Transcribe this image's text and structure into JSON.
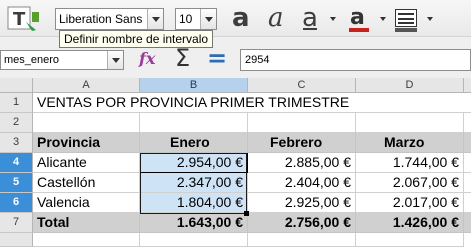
{
  "toolbar": {
    "font_name": "Liberation Sans",
    "font_size": "10",
    "bold_icon": "a",
    "italic_icon": "a",
    "underline_icon": "a",
    "font_color_icon": "a",
    "font_color": "#c9211e",
    "tooltip": "Definir nombre de intervalo"
  },
  "formula_bar": {
    "name_box": "mes_enero",
    "fx_icon": "fx",
    "sum_icon": "Σ",
    "equals_icon": "=",
    "formula": "2954"
  },
  "columns": [
    "A",
    "B",
    "C",
    "D"
  ],
  "rows": [
    "1",
    "2",
    "3",
    "4",
    "5",
    "6",
    "7"
  ],
  "sheet": {
    "title": "VENTAS POR PROVINCIA PRIMER TRIMESTRE",
    "headers": [
      "Provincia",
      "Enero",
      "Febrero",
      "Marzo"
    ],
    "data": [
      [
        "Alicante",
        "2.954,00 €",
        "2.885,00 €",
        "1.744,00 €"
      ],
      [
        "Castellón",
        "2.347,00 €",
        "2.404,00 €",
        "2.067,00 €"
      ],
      [
        "Valencia",
        "1.804,00 €",
        "2.925,00 €",
        "2.017,00 €"
      ]
    ],
    "total": [
      "Total",
      "1.643,00 €",
      "2.756,00 €",
      "1.426,00 €"
    ]
  },
  "colors": {
    "selection": "#cfe3f7",
    "header_gray": "#d0d0d0",
    "selected_row_header": "#3a8fd8"
  }
}
